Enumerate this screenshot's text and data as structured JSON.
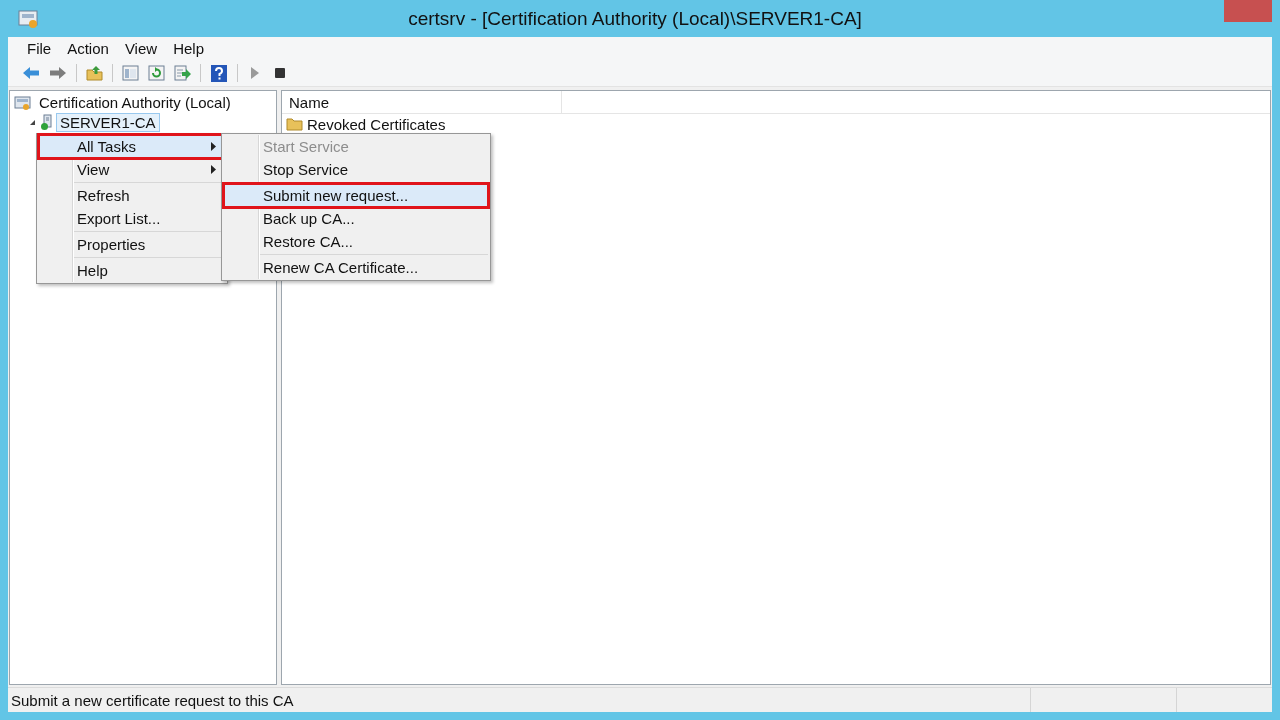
{
  "window": {
    "title": "certsrv - [Certification Authority (Local)\\SERVER1-CA]"
  },
  "menu_bar": [
    "File",
    "Action",
    "View",
    "Help"
  ],
  "tree": {
    "items": [
      {
        "label": "Certification Authority (Local)",
        "selected": false,
        "expanded": true,
        "children": [
          {
            "label": "SERVER1-CA",
            "selected": true
          }
        ]
      }
    ]
  },
  "list": {
    "columns": [
      "Name"
    ],
    "rows": [
      "Revoked Certificates"
    ]
  },
  "context_menu": {
    "items": [
      {
        "kind": "item",
        "label": "All Tasks",
        "submenu": true,
        "selected": true,
        "annotated": true
      },
      {
        "kind": "item",
        "label": "View",
        "submenu": true,
        "selected": false,
        "annotated": false
      },
      {
        "kind": "separator"
      },
      {
        "kind": "item",
        "label": "Refresh",
        "submenu": false,
        "selected": false,
        "annotated": false
      },
      {
        "kind": "item",
        "label": "Export List...",
        "submenu": false,
        "selected": false,
        "annotated": false
      },
      {
        "kind": "separator"
      },
      {
        "kind": "item",
        "label": "Properties",
        "submenu": false,
        "selected": false,
        "annotated": false
      },
      {
        "kind": "separator"
      },
      {
        "kind": "item",
        "label": "Help",
        "submenu": false,
        "selected": false,
        "annotated": false
      }
    ]
  },
  "submenu": {
    "items": [
      {
        "kind": "item",
        "label": "Start Service",
        "disabled": true,
        "selected": false,
        "annotated": false
      },
      {
        "kind": "item",
        "label": "Stop Service",
        "disabled": false,
        "selected": false,
        "annotated": false
      },
      {
        "kind": "separator"
      },
      {
        "kind": "item",
        "label": "Submit new request...",
        "disabled": false,
        "selected": true,
        "annotated": true
      },
      {
        "kind": "item",
        "label": "Back up CA...",
        "disabled": false,
        "selected": false,
        "annotated": false
      },
      {
        "kind": "item",
        "label": "Restore CA...",
        "disabled": false,
        "selected": false,
        "annotated": false
      },
      {
        "kind": "separator"
      },
      {
        "kind": "item",
        "label": "Renew CA Certificate...",
        "disabled": false,
        "selected": false,
        "annotated": false
      }
    ]
  },
  "status_bar": {
    "text": "Submit a new certificate request to this CA"
  }
}
